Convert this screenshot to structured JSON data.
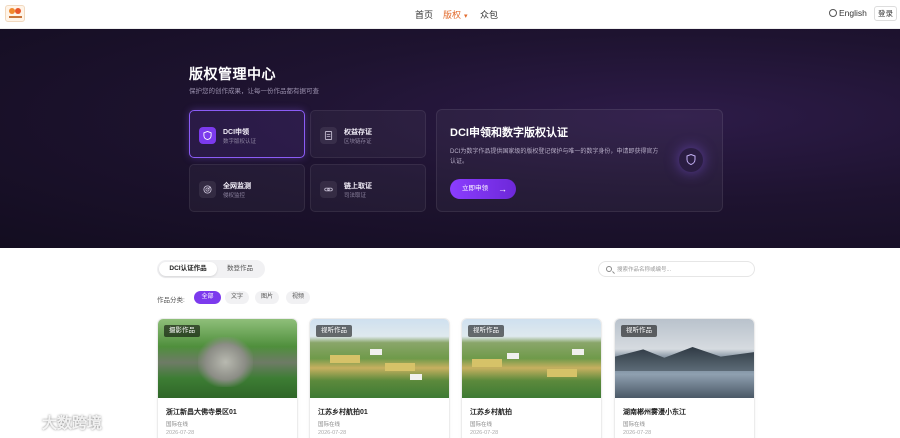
{
  "nav": {
    "items": [
      {
        "label": "首页",
        "active": false
      },
      {
        "label": "版权",
        "active": true
      },
      {
        "label": "众包",
        "active": false
      }
    ],
    "language": "English",
    "login": "登录",
    "accent_color": "#e26a2c"
  },
  "hero": {
    "title": "版权管理中心",
    "subtitle": "保护您的创作成果，让每一份作品都有据可查",
    "features": [
      {
        "title": "DCI申领",
        "subtitle": "数字版权认证",
        "icon": "shield-icon",
        "active": true
      },
      {
        "title": "权益存证",
        "subtitle": "区块链存证",
        "icon": "document-icon",
        "active": false
      },
      {
        "title": "全网监测",
        "subtitle": "侵权监控",
        "icon": "radar-icon",
        "active": false
      },
      {
        "title": "链上取证",
        "subtitle": "司法取证",
        "icon": "link-icon",
        "active": false
      }
    ],
    "dci": {
      "title": "DCI申领和数字版权认证",
      "description": "DCI为数字作品提供国家级的版权登记保护与唯一的数字身份，申请即获得官方认证。",
      "button": "立即申领",
      "icon": "shield-icon"
    },
    "accent_color": "#7c3aed"
  },
  "content": {
    "tabs": [
      {
        "label": "DCI认证作品",
        "active": true
      },
      {
        "label": "数登作品",
        "active": false
      }
    ],
    "search_placeholder": "搜索作品名称或编号...",
    "filter_label": "作品分类:",
    "filters": [
      {
        "label": "全部",
        "active": true
      },
      {
        "label": "文字",
        "active": false
      },
      {
        "label": "图片",
        "active": false
      },
      {
        "label": "视频",
        "active": false
      }
    ],
    "cards": [
      {
        "badge": "摄影作品",
        "title": "浙江新昌大佛寺景区01",
        "author": "国际在线",
        "date": "2026-07-28"
      },
      {
        "badge": "视听作品",
        "title": "江苏乡村航拍01",
        "author": "国际在线",
        "date": "2026-07-28"
      },
      {
        "badge": "视听作品",
        "title": "江苏乡村航拍",
        "author": "国际在线",
        "date": "2026-07-28"
      },
      {
        "badge": "视听作品",
        "title": "湖南郴州雾漫小东江",
        "author": "国际在线",
        "date": "2026-07-28"
      }
    ]
  },
  "watermark": {
    "text": "大数跨境"
  }
}
